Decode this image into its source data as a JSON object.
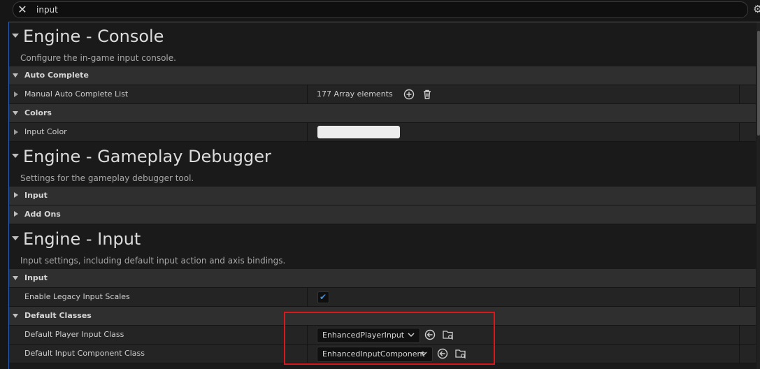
{
  "search": {
    "value": "input",
    "clear_icon": "close-icon",
    "settings_icon": "gear-icon"
  },
  "sections": {
    "console": {
      "title": "Engine - Console",
      "description": "Configure the in-game input console.",
      "cat_autocomplete": "Auto Complete",
      "manual_list_label": "Manual Auto Complete List",
      "manual_list_value": "177 Array elements",
      "cat_colors": "Colors",
      "input_color_label": "Input Color",
      "input_color_value": "#ececec"
    },
    "debugger": {
      "title": "Engine - Gameplay Debugger",
      "description": "Settings for the gameplay debugger tool.",
      "cat_input": "Input",
      "cat_addons": "Add Ons"
    },
    "input": {
      "title": "Engine - Input",
      "description": "Input settings, including default input action and axis bindings.",
      "cat_input": "Input",
      "legacy_label": "Enable Legacy Input Scales",
      "legacy_checked": true,
      "cat_default_classes": "Default Classes",
      "player_input_label": "Default Player Input Class",
      "player_input_value": "EnhancedPlayerInput",
      "component_label": "Default Input Component Class",
      "component_value": "EnhancedInputComponent"
    }
  },
  "colors": {
    "accent": "#2b5fb2",
    "highlight": "#d7191c",
    "checkmark": "#3b8fe0"
  }
}
